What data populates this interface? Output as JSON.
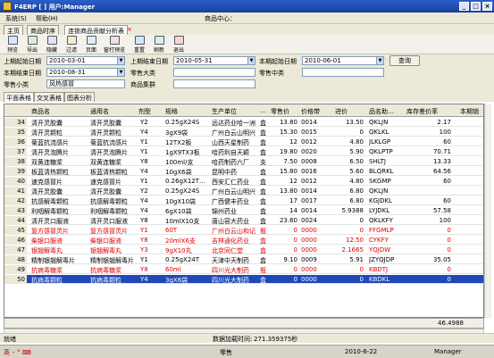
{
  "window": {
    "title": "F4ERP [ ] 用户:Manager",
    "buttons": [
      "_",
      "□",
      "×"
    ]
  },
  "menu": {
    "items": [
      "系统(S)",
      "帮助(H)"
    ],
    "center_label": "商品中心："
  },
  "doc_tabs": [
    "主页",
    "商品时序",
    "连锁商品贡献分析表"
  ],
  "toolbar": [
    {
      "label": "预览",
      "icon": "preview-icon"
    },
    {
      "label": "导出",
      "icon": "export-icon"
    },
    {
      "label": "隐藏",
      "icon": "hide-icon"
    },
    {
      "label": "过滤",
      "icon": "filter-icon"
    },
    {
      "label": "页面",
      "icon": "page-icon"
    },
    {
      "label": "窗打预览",
      "icon": "print-preview-icon"
    },
    {
      "label": "重置",
      "icon": "reset-icon"
    },
    {
      "label": "刷新",
      "icon": "refresh-icon"
    },
    {
      "label": "退出",
      "icon": "exit-icon"
    }
  ],
  "filters": {
    "prev_start_label": "上期起始日期",
    "prev_start": "2010-03-01",
    "prev_end_label": "上期结束日期",
    "prev_end": "2010-05-31",
    "cur_start_label": "本期起始日期",
    "cur_start": "2010-06-01",
    "cur_end_label": "本期结束日期",
    "cur_end": "2010-08-31",
    "category_large_label": "零售大类",
    "category_large": "",
    "category_mid_label": "零售中类",
    "category_mid": "",
    "category_small_label": "零售小类",
    "category_small": "风热感冒",
    "product_set_label": "商品集群",
    "product_set": "",
    "query_button": "查询"
  },
  "sub_tabs": [
    "平面表格",
    "交叉表格",
    "图表分析"
  ],
  "table": {
    "columns": [
      "商品名",
      "通用名",
      "剂型",
      "规格",
      "生产单位",
      "…",
      "零售价",
      "价格带",
      "进价",
      "品名助…",
      "库存差价率",
      "本期销"
    ],
    "rows": [
      {
        "n": "34",
        "name": "清开灵胶囊",
        "generic": "清开灵胶囊",
        "form": "Y2",
        "spec": "0.25gX24S",
        "maker": "远达药业哈一洲",
        "unit": "盒",
        "price": "13.80",
        "band": "0014",
        "cost": "13.50",
        "code": "QKLJN",
        "rate": "2.17",
        "red": false
      },
      {
        "n": "35",
        "name": "清开灵颗粒",
        "generic": "清开灵颗粒",
        "form": "Y4",
        "spec": "3gX9袋",
        "maker": "广州白云山明兴",
        "unit": "盒",
        "price": "15.30",
        "band": "0015",
        "cost": "0",
        "code": "QKLKL",
        "rate": "100",
        "red": false
      },
      {
        "n": "36",
        "name": "菊蓝抗流感片",
        "generic": "菊蓝抗流感片",
        "form": "Y1",
        "spec": "12TX2板",
        "maker": "山西天星制药",
        "unit": "盒",
        "price": "12",
        "band": "0012",
        "cost": "4.80",
        "code": "JLKLGP",
        "rate": "60",
        "red": false
      },
      {
        "n": "37",
        "name": "清开灵泡腾片",
        "generic": "清开灵泡腾片",
        "form": "Y1",
        "spec": "1gX9TX3板",
        "maker": "哈药利自天颖",
        "unit": "盒",
        "price": "19.80",
        "band": "0020",
        "cost": "5.90",
        "code": "QKLPTP",
        "rate": "70.71",
        "red": false
      },
      {
        "n": "38",
        "name": "双黄连糖浆",
        "generic": "双黄连糖浆",
        "form": "Y8",
        "spec": "100ml/支",
        "maker": "哈药制药六厂",
        "unit": "支",
        "price": "7.50",
        "band": "0008",
        "cost": "6.50",
        "code": "SHLTJ",
        "rate": "13.33",
        "red": false
      },
      {
        "n": "39",
        "name": "板蓝清热颗粒",
        "generic": "板蓝清热颗粒",
        "form": "Y4",
        "spec": "10gX6袋",
        "maker": "昆明中药",
        "unit": "盒",
        "price": "15.80",
        "band": "0016",
        "cost": "5.60",
        "code": "BLQRKL",
        "rate": "64.56",
        "red": false
      },
      {
        "n": "40",
        "name": "速克感冒片",
        "generic": "速克感冒片",
        "form": "Y1",
        "spec": "0.26gX12T…",
        "maker": "西安汇仁药业",
        "unit": "盒",
        "price": "12",
        "band": "0012",
        "cost": "4.80",
        "code": "SKGMP",
        "rate": "60",
        "red": false
      },
      {
        "n": "41",
        "name": "清开灵胶囊",
        "generic": "清开灵胶囊",
        "form": "Y2",
        "spec": "0.25gX24S",
        "maker": "广州白云山明兴",
        "unit": "盒",
        "price": "13.80",
        "band": "0014",
        "cost": "6.80",
        "code": "QKLJN",
        "rate": "",
        "red": false
      },
      {
        "n": "42",
        "name": "抗感解毒颗粒",
        "generic": "抗感解毒颗粒",
        "form": "Y4",
        "spec": "10gX10袋",
        "maker": "广西健丰药业",
        "unit": "盒",
        "price": "17",
        "band": "0017",
        "cost": "6.80",
        "code": "KGJDKL",
        "rate": "60",
        "red": false
      },
      {
        "n": "43",
        "name": "利咽解毒颗粒",
        "generic": "利咽解毒颗粒",
        "form": "Y4",
        "spec": "6gX10袋",
        "maker": "锦州药业",
        "unit": "盒",
        "price": "14",
        "band": "0014",
        "cost": "5.9388",
        "code": "LYJDKL",
        "rate": "57.58",
        "red": false
      },
      {
        "n": "44",
        "name": "清开灵口服液",
        "generic": "清开灵口服液",
        "form": "Y8",
        "spec": "10mlX10支",
        "maker": "唐山容大药业",
        "unit": "盒",
        "price": "23.60",
        "band": "0024",
        "cost": "0",
        "code": "QKLKFY",
        "rate": "100",
        "red": false
      },
      {
        "n": "45",
        "name": "复方感冒灵片",
        "generic": "复方感冒灵片",
        "form": "Y1",
        "spec": "60T",
        "maker": "广州白云山和记",
        "unit": "瓶",
        "price": "0",
        "band": "0000",
        "cost": "0",
        "code": "FFGMLP",
        "rate": "0",
        "red": true
      },
      {
        "n": "46",
        "name": "柴银口服液",
        "generic": "柴银口服液",
        "form": "Y8",
        "spec": "20mlX6支",
        "maker": "吉林通化药业",
        "unit": "盒",
        "price": "0",
        "band": "0000",
        "cost": "12.50",
        "code": "CYKFY",
        "rate": "0",
        "red": true
      },
      {
        "n": "47",
        "name": "银翘解毒丸",
        "generic": "银翘解毒丸",
        "form": "Y3",
        "spec": "9gX10丸",
        "maker": "北京同仁堂",
        "unit": "盒",
        "price": "0",
        "band": "0000",
        "cost": "2.1665",
        "code": "YQJDW",
        "rate": "0",
        "red": true
      },
      {
        "n": "48",
        "name": "精制银翘解毒片",
        "generic": "精制银翘解毒片",
        "form": "Y1",
        "spec": "0.25gX24T",
        "maker": "天津中天制药",
        "unit": "盒",
        "price": "9.10",
        "band": "0009",
        "cost": "5.91",
        "code": "JZYQJDP",
        "rate": "35.05",
        "red": false
      },
      {
        "n": "49",
        "name": "抗病毒糖浆",
        "generic": "抗病毒糖浆",
        "form": "Y8",
        "spec": "60ml",
        "maker": "四川光大制药",
        "unit": "瓶",
        "price": "0",
        "band": "0000",
        "cost": "0",
        "code": "KBDTJ",
        "rate": "0",
        "red": true
      },
      {
        "n": "50",
        "name": "抗病毒颗粒",
        "generic": "抗病毒颗粒",
        "form": "Y4",
        "spec": "3gX6袋",
        "maker": "四川光大制药",
        "unit": "盒",
        "price": "0",
        "band": "0000",
        "cost": "0",
        "code": "KBDKL",
        "rate": "0",
        "red": false,
        "selected": true
      }
    ],
    "total_rate": "46.4988"
  },
  "status": {
    "left": "就绪",
    "load_time_label": "数据加载时间:",
    "load_time": "271.359375秒"
  },
  "taskbar": {
    "module": "零售",
    "date": "2010-6-22",
    "user": "Manager"
  },
  "colors": {
    "selected_row": "#1f49b8",
    "warning_text": "#e00000",
    "titlebar": "#2b5fc8"
  }
}
